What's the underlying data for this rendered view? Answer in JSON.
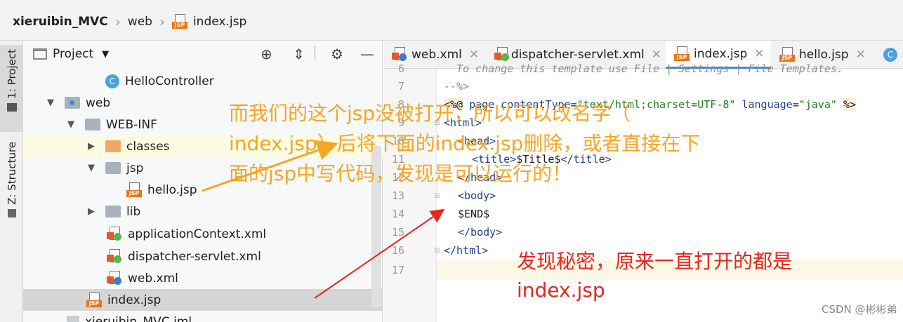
{
  "breadcrumb": {
    "project": "xieruibin_MVC",
    "folder": "web",
    "file": "index.jsp"
  },
  "toolwindows": {
    "project_tab": "1: Project",
    "structure_tab": "Z: Structure"
  },
  "project_panel": {
    "title": "Project",
    "tree": [
      {
        "label": "HelloController",
        "icon": "class-icon",
        "kind": "class"
      },
      {
        "label": "web",
        "icon": "web-folder-icon",
        "kind": "webfolder",
        "arrow": "down"
      },
      {
        "label": "WEB-INF",
        "icon": "folder-icon",
        "kind": "folder",
        "arrow": "down"
      },
      {
        "label": "classes",
        "icon": "folder-orange-icon",
        "kind": "folder-orange",
        "arrow": "right"
      },
      {
        "label": "jsp",
        "icon": "folder-icon",
        "kind": "folder",
        "arrow": "down"
      },
      {
        "label": "hello.jsp",
        "icon": "jsp-file-icon",
        "kind": "jsp"
      },
      {
        "label": "lib",
        "icon": "folder-icon",
        "kind": "folder",
        "arrow": "right"
      },
      {
        "label": "applicationContext.xml",
        "icon": "spring-xml-icon",
        "kind": "xml-spring"
      },
      {
        "label": "dispatcher-servlet.xml",
        "icon": "spring-xml-icon",
        "kind": "xml-spring"
      },
      {
        "label": "web.xml",
        "icon": "web-xml-icon",
        "kind": "xml-web"
      },
      {
        "label": "index.jsp",
        "icon": "jsp-file-icon",
        "kind": "jsp"
      },
      {
        "label": "xieruibin_MVC.iml",
        "icon": "iml-file-icon",
        "kind": "iml"
      }
    ]
  },
  "editor_tabs": [
    {
      "label": "web.xml",
      "icon": "web-xml-icon"
    },
    {
      "label": "dispatcher-servlet.xml",
      "icon": "spring-xml-icon"
    },
    {
      "label": "index.jsp",
      "icon": "jsp-file-icon",
      "active": true
    },
    {
      "label": "hello.jsp",
      "icon": "jsp-file-icon"
    }
  ],
  "editor": {
    "line_numbers": [
      "6",
      "7",
      "8",
      "9",
      "10",
      "11",
      "12",
      "13",
      "14",
      "15",
      "16",
      "17"
    ],
    "line6": "  To change this template use File | Settings | File Templates.",
    "line7": "--%>",
    "line8_directive": "page",
    "line8_attr1": "contentType",
    "line8_val1": "\"text/html;charset=UTF-8\"",
    "line8_attr2": "language",
    "line8_val2": "\"java\"",
    "line9": "<html>",
    "line10": "<head>",
    "line11_open": "<title>",
    "line11_text": "$Title$",
    "line11_close": "</title>",
    "line12": "</head>",
    "line13": "<body>",
    "line14": "$END$",
    "line15": "</body>",
    "line16": "</html>"
  },
  "annotations": {
    "orange_line1": "而我们的这个jsp没被打开，所以可以改名字（",
    "orange_line2": "index.jsp）后将下面的index.jsp删除，或者直接在下",
    "orange_line3": "面的jsp中写代码，发现是可以运行的！",
    "red_line1": "发现秘密，原来一直打开的都是",
    "red_line2": "index.jsp",
    "orange_color": "#f5a623",
    "red_color": "#e8251e"
  },
  "watermark": "CSDN @彬彬弟"
}
